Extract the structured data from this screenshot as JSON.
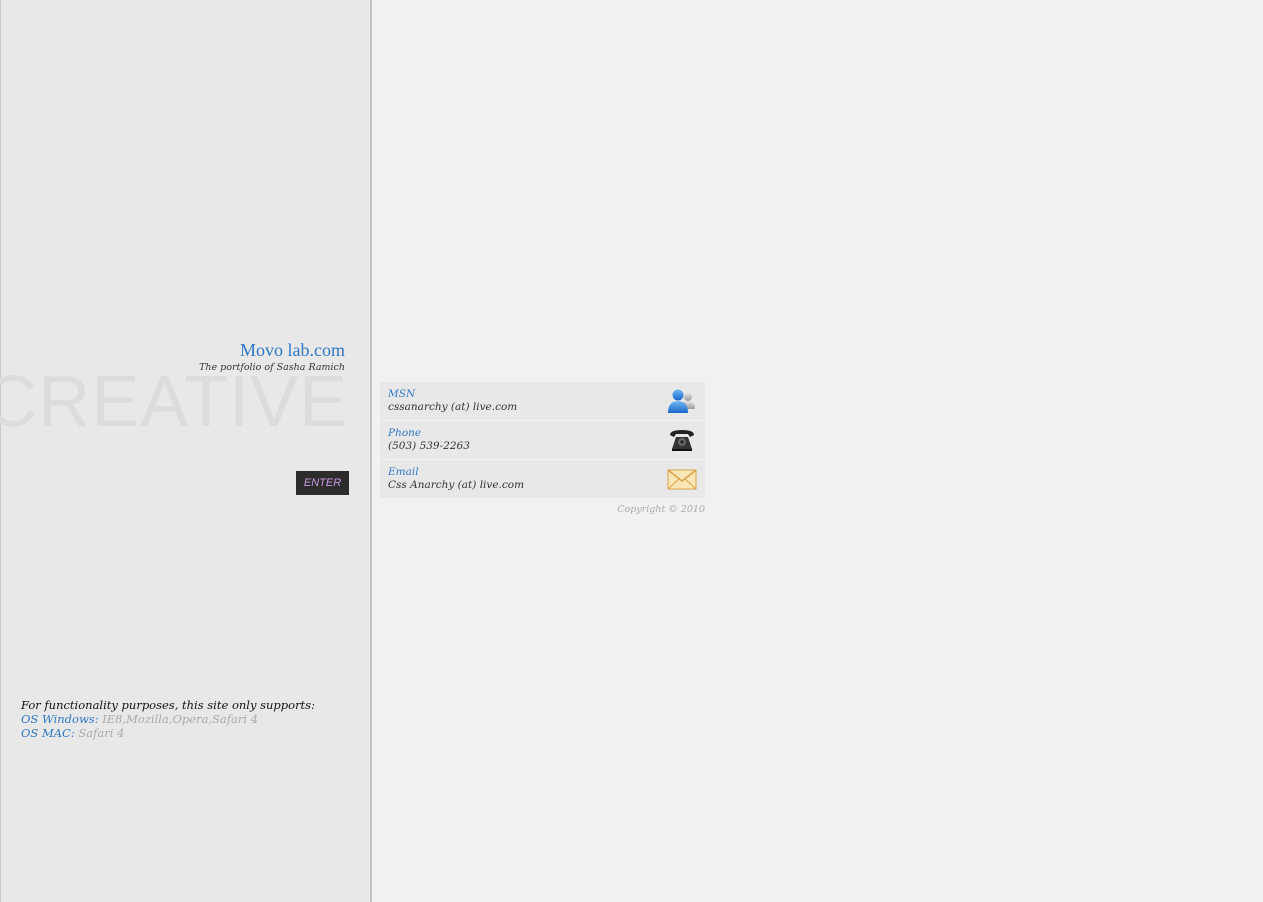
{
  "brand": {
    "title": "Movo lab.com",
    "tagline": "The portfolio of Sasha Ramich",
    "watermark": "CREATIVE"
  },
  "enter_button": {
    "label": "ENTER"
  },
  "support": {
    "intro": "For functionality purposes, this site only supports:",
    "windows_label": "OS Windows:",
    "windows_browsers": "IE8,Mozilla,Opera,Safari 4",
    "mac_label": "OS MAC:",
    "mac_browsers": "Safari 4"
  },
  "contacts": [
    {
      "label": "MSN",
      "value": "cssanarchy (at) live.com",
      "icon": "msn-user-icon"
    },
    {
      "label": "Phone",
      "value": "(503) 539-2263",
      "icon": "telephone-icon"
    },
    {
      "label": "Email",
      "value": "Css Anarchy (at) live.com",
      "icon": "envelope-icon"
    }
  ],
  "copyright": "Copyright © 2010",
  "colors": {
    "accent_blue": "#2f78c8",
    "enter_bg": "#2c2c2c",
    "enter_text": "#c79be0",
    "sidebar_bg": "#e8e8e8",
    "page_bg": "#f1f1f1"
  }
}
